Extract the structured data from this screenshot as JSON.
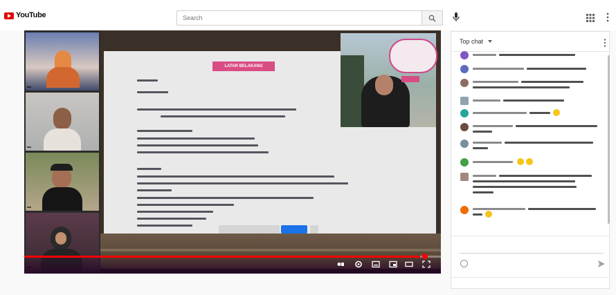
{
  "header": {
    "logo_text": "YouTube",
    "logo_superscript": "",
    "search_placeholder": "Search",
    "icons": [
      "youtube-logo-icon",
      "search-icon",
      "microphone-icon",
      "apps-grid-icon",
      "more-vert-icon"
    ]
  },
  "player": {
    "caption_text": "",
    "progress": 0.95,
    "tiles": [
      {
        "name": ""
      },
      {
        "name": ""
      },
      {
        "name": ""
      },
      {
        "name": ""
      }
    ],
    "slide": {
      "title": "LATAR BELAKANG"
    },
    "subtitle_buttons": {
      "primary": ""
    },
    "controls": [
      "play-icon",
      "next-icon",
      "settings-icon",
      "subtitles-icon",
      "miniplayer-icon",
      "theater-icon",
      "fullscreen-icon",
      "live-icon"
    ]
  },
  "video": {
    "title": ""
  },
  "chat": {
    "mode_label": "Top chat",
    "placeholder": "",
    "char_count": "",
    "hide_label": "",
    "messages": [
      {
        "avatar_color": "#7e57c2"
      },
      {
        "avatar_color": "#5c6bc0"
      },
      {
        "avatar_color": "#8d6e63"
      },
      {
        "avatar_color": "#90a4ae"
      },
      {
        "avatar_color": "#26a69a"
      },
      {
        "avatar_color": "#6d4c41"
      },
      {
        "avatar_color": "#78909c"
      },
      {
        "avatar_color": "#43a047"
      },
      {
        "avatar_color": "#a1887f"
      },
      {
        "avatar_color": "#ef6c00"
      }
    ]
  },
  "colors": {
    "accent_red": "#ff0000",
    "slide_title_bg": "#d84d83",
    "caption_color": "#f0d8ef"
  }
}
